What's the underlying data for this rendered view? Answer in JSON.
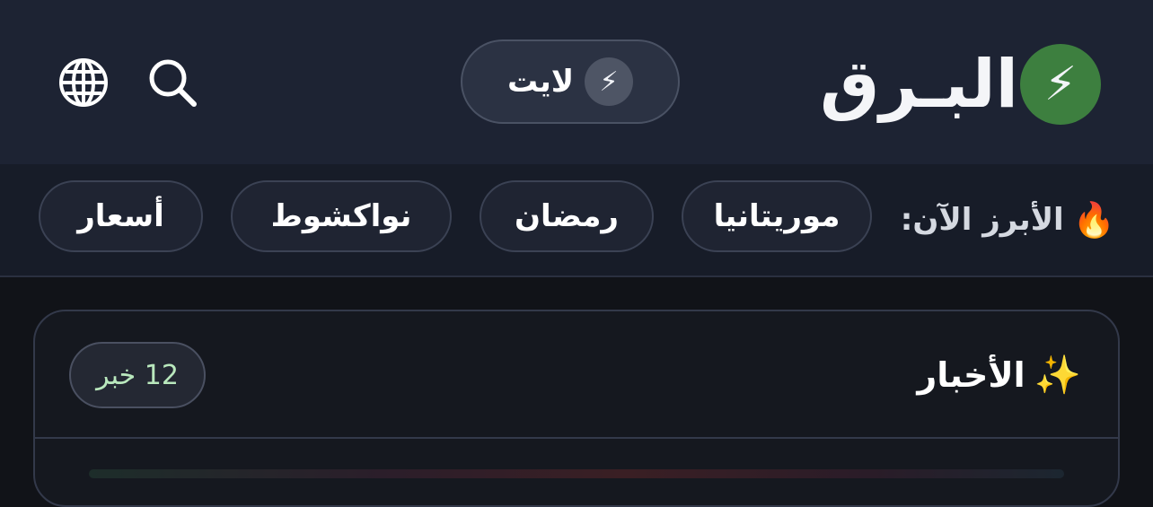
{
  "header": {
    "logo_text": "البـرق",
    "logo_icon": "⚡",
    "lite_button": {
      "label": "لايت",
      "icon": "⚡"
    },
    "icons": {
      "search": "search-icon",
      "language": "globe-icon"
    }
  },
  "trending": {
    "title": "الأبرز الآن:",
    "icon": "🔥",
    "chips": [
      "موريتانيا",
      "رمضان",
      "نواكشوط",
      "أسعار"
    ]
  },
  "news": {
    "title": "الأخبار",
    "icon": "✨",
    "count": "12 خبر"
  },
  "colors": {
    "header_bg": "#1d2333",
    "page_bg": "#111318",
    "logo_badge": "#3d7f3f",
    "count_text": "#b9e8bd"
  }
}
